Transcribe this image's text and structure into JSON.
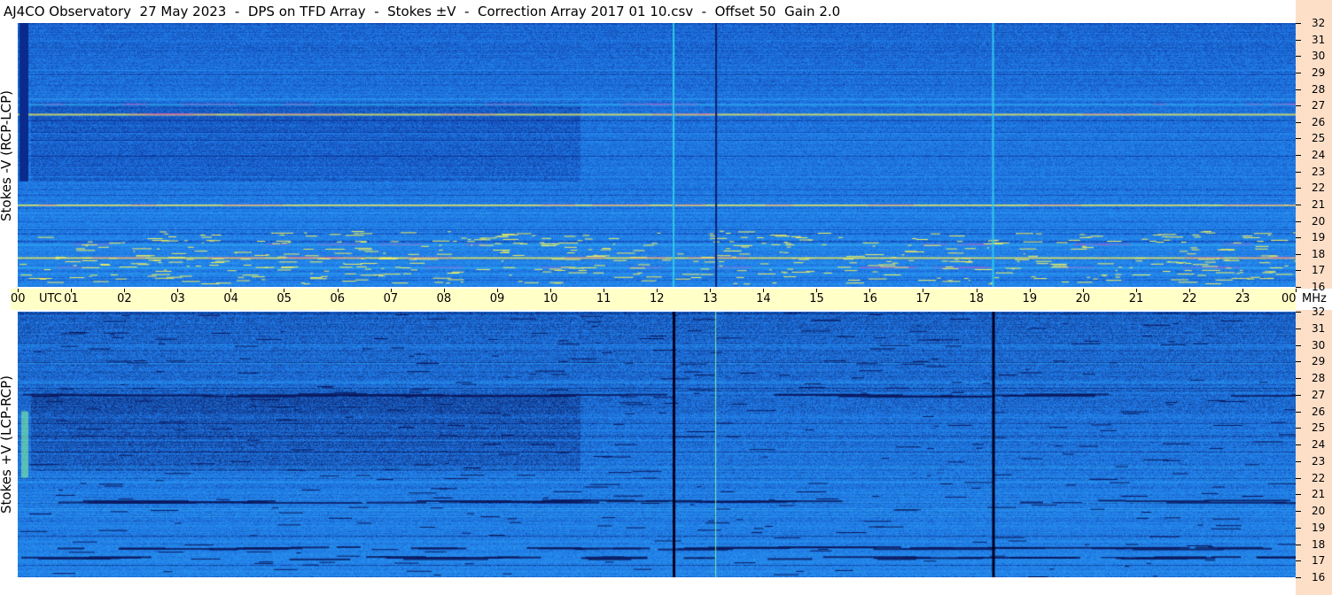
{
  "title": "AJ4CO Observatory  27 May 2023  -  DPS on TFD Array  -  Stokes ±V  -  Correction Array 2017 01 10.csv  -  Offset 50  Gain 2.0",
  "chart_data": [
    {
      "type": "heatmap",
      "panel": "top",
      "ylabel": "Stokes -V (RCP-LCP)",
      "x_ticks": [
        "00",
        "01",
        "02",
        "03",
        "04",
        "05",
        "06",
        "07",
        "08",
        "09",
        "10",
        "11",
        "12",
        "13",
        "14",
        "15",
        "16",
        "17",
        "18",
        "19",
        "20",
        "21",
        "22",
        "23",
        "00"
      ],
      "x_unit_label": "UTC",
      "xlim": [
        0,
        24
      ],
      "y_ticks": [
        32,
        31,
        30,
        29,
        28,
        27,
        26,
        25,
        24,
        23,
        22,
        21,
        20,
        19,
        18,
        17,
        16
      ],
      "ylim": [
        16,
        32
      ],
      "y_unit": "MHz",
      "colors": {
        "base": "#1f78e6",
        "light": "#2ea8f0",
        "dark": "#0a2a8c",
        "hot": "#f0f060",
        "magenta": "#e040c0"
      },
      "features": {
        "vertical_lines_utc": [
          12.3,
          13.1,
          18.3
        ],
        "bright_bands_mhz": [
          17.2,
          17.8,
          18.6,
          21.0,
          27.1,
          26.5
        ]
      }
    },
    {
      "type": "heatmap",
      "panel": "bottom",
      "ylabel": "Stokes +V (LCP-RCP)",
      "x_ticks": [
        "00",
        "01",
        "02",
        "03",
        "04",
        "05",
        "06",
        "07",
        "08",
        "09",
        "10",
        "11",
        "12",
        "13",
        "14",
        "15",
        "16",
        "17",
        "18",
        "19",
        "20",
        "21",
        "22",
        "23",
        "00"
      ],
      "xlim": [
        0,
        24
      ],
      "y_ticks": [
        32,
        31,
        30,
        29,
        28,
        27,
        26,
        25,
        24,
        23,
        22,
        21,
        20,
        19,
        18,
        17,
        16
      ],
      "ylim": [
        16,
        32
      ],
      "y_unit": "MHz",
      "colors": {
        "base": "#1f78e6",
        "light": "#2ea8f0",
        "dark": "#0a1a60",
        "hot": "#80f0a0"
      },
      "features": {
        "vertical_lines_utc": [
          12.3,
          13.1,
          18.3
        ],
        "dark_bands_mhz": [
          17.8,
          17.2,
          20.6,
          27.0
        ]
      }
    }
  ],
  "time_axis": {
    "utc_label": "UTC",
    "mhz_label": "MHz"
  },
  "colors": {
    "freq_axis_bg": "#fddfc8",
    "time_axis_bg": "#ffffc8"
  }
}
